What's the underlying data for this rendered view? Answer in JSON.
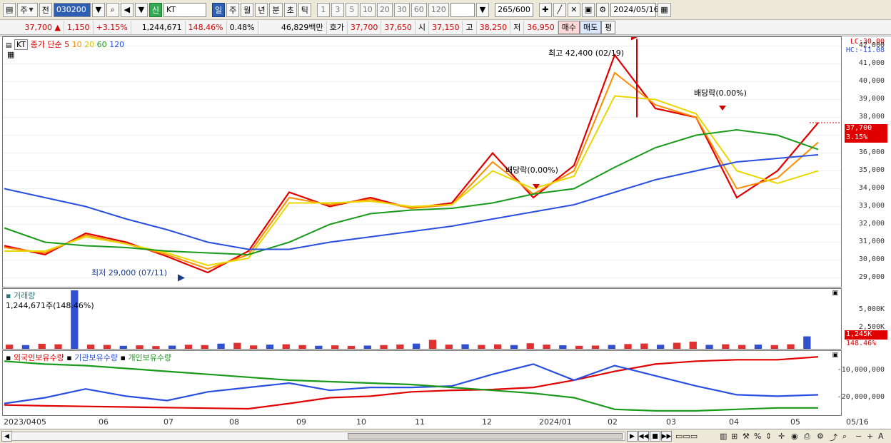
{
  "toolbar": {
    "period_mode": "주",
    "prev_label": "전",
    "code": "030200",
    "name": "KT",
    "badge": "신",
    "periods": [
      "일",
      "주",
      "월",
      "년",
      "분",
      "초",
      "틱"
    ],
    "active_period": "일",
    "intervals": [
      "1",
      "3",
      "5",
      "10",
      "20",
      "30",
      "60",
      "120"
    ],
    "count": "265",
    "count_total": "/600",
    "date": "2024/05/16"
  },
  "info": {
    "price": "37,700",
    "change_arrow": "▲",
    "change": "1,150",
    "change_pct": "+3.15%",
    "volume": "1,244,671",
    "volume_ratio": "148.46%",
    "turnover_rate": "0.48%",
    "trade_value": "46,829백만",
    "bid_label": "호가",
    "bid1": "37,700",
    "bid2": "37,650",
    "open_label": "시",
    "open": "37,150",
    "high_label": "고",
    "high": "38,250",
    "low_label": "저",
    "low": "36,950",
    "buy_label": "매수",
    "sell_label": "매도",
    "eval_label": "평"
  },
  "price_pane": {
    "symbol_tag": "KT",
    "legend_prefix": "종가 단순",
    "ma": [
      {
        "period": "5",
        "color": "#e00000"
      },
      {
        "period": "10",
        "color": "#ff8c00"
      },
      {
        "period": "20",
        "color": "#e8d800"
      },
      {
        "period": "60",
        "color": "#1a9a1a"
      },
      {
        "period": "120",
        "color": "#2a4fe0"
      }
    ],
    "lc_label": "LC:30.00",
    "hc_label": "HC:-11.08",
    "yticks": [
      "42,000",
      "41,000",
      "40,000",
      "39,000",
      "38,000",
      "37,000",
      "36,000",
      "35,000",
      "34,000",
      "33,000",
      "32,000",
      "31,000",
      "30,000",
      "29,000"
    ],
    "current_price": "37,700",
    "current_pct": "3.15%",
    "high_annotation": "최고 42,400 (02/19)",
    "low_annotation": "최저 29,000 (07/11)",
    "dividend_1": "배당락(0.00%)",
    "dividend_2": "배당락(0.00%)"
  },
  "volume_pane": {
    "title": "거래량",
    "value_label": "1,244,671주(148.46%)",
    "yticks": [
      "5,000K",
      "2,500K"
    ],
    "current": "1,245K",
    "current_pct": "148.46%"
  },
  "holding_pane": {
    "legend": [
      {
        "label": "외국인보유수량",
        "color": "#e00000"
      },
      {
        "label": "기관보유수량",
        "color": "#2a4fe0"
      },
      {
        "label": "개인보유수량",
        "color": "#1a9a1a"
      }
    ],
    "yticks": [
      "-10,000,000",
      "-20,000,000"
    ]
  },
  "xaxis": {
    "labels": [
      "2023/04",
      "05",
      "06",
      "07",
      "08",
      "09",
      "10",
      "11",
      "12",
      "2024/01",
      "02",
      "03",
      "04",
      "05"
    ],
    "right_label": "05/16"
  },
  "chart_data": {
    "type": "line",
    "title": "",
    "series": [
      {
        "name": "5",
        "values": [
          30800,
          30300,
          31500,
          31000,
          30200,
          29300,
          30500,
          33800,
          33000,
          33500,
          32900,
          33200,
          36000,
          33500,
          35300,
          41500,
          38500,
          38000,
          33500,
          35000,
          37700
        ]
      },
      {
        "name": "10",
        "values": [
          30700,
          30400,
          31400,
          30900,
          30300,
          29500,
          30300,
          33500,
          33100,
          33400,
          32900,
          33100,
          35500,
          33700,
          35000,
          40500,
          38700,
          38000,
          34000,
          34600,
          36600
        ]
      },
      {
        "name": "20",
        "values": [
          30500,
          30500,
          31300,
          30900,
          30400,
          29700,
          30100,
          33200,
          33200,
          33300,
          33000,
          33100,
          35000,
          34000,
          34700,
          39200,
          39000,
          38200,
          35000,
          34300,
          35000
        ]
      },
      {
        "name": "60",
        "values": [
          31800,
          31000,
          30800,
          30700,
          30500,
          30400,
          30300,
          31000,
          32000,
          32600,
          32800,
          32900,
          33200,
          33700,
          34000,
          35200,
          36300,
          37000,
          37300,
          37000,
          36200
        ]
      },
      {
        "name": "120",
        "values": [
          34000,
          33500,
          33000,
          32300,
          31700,
          31000,
          30600,
          30600,
          31000,
          31300,
          31600,
          31900,
          32300,
          32700,
          33100,
          33800,
          34500,
          35000,
          35500,
          35700,
          35900
        ]
      }
    ],
    "ylim": [
      28500,
      42500
    ],
    "volume_ylim": [
      0,
      6000
    ],
    "volume_values": [
      420,
      380,
      510,
      460,
      6500,
      420,
      390,
      300,
      350,
      280,
      320,
      410,
      380,
      520,
      600,
      340,
      420,
      460,
      380,
      310,
      350,
      290,
      330,
      380,
      430,
      520,
      900,
      420,
      460,
      390,
      450,
      380,
      560,
      420,
      360,
      300,
      330,
      390,
      480,
      530,
      410,
      610,
      720,
      400,
      460,
      390,
      420,
      380,
      460,
      1250
    ],
    "foreign_values": [
      -22500000,
      -22800000,
      -23000000,
      -23200000,
      -23400000,
      -23600000,
      -23800000,
      -22000000,
      -20000000,
      -19500000,
      -18000000,
      -17500000,
      -17200000,
      -16500000,
      -14000000,
      -11000000,
      -8500000,
      -7500000,
      -7000000,
      -7000000,
      -6000000
    ],
    "institution_values": [
      -22000000,
      -20000000,
      -17000000,
      -19500000,
      -21000000,
      -18000000,
      -16500000,
      -15000000,
      -17500000,
      -16500000,
      -16500000,
      -16000000,
      -12000000,
      -8500000,
      -14000000,
      -9000000,
      -12500000,
      -16000000,
      -19000000,
      -19500000,
      -19000000
    ],
    "individual_values": [
      -7500000,
      -8500000,
      -9000000,
      -10000000,
      -11000000,
      -12000000,
      -13000000,
      -14000000,
      -14500000,
      -15000000,
      -15500000,
      -16500000,
      -17500000,
      -18500000,
      -20000000,
      -24000000,
      -24500000,
      -24500000,
      -24000000,
      -23500000,
      -23500000
    ],
    "holding_ylim": [
      -26000000,
      -4000000
    ]
  }
}
